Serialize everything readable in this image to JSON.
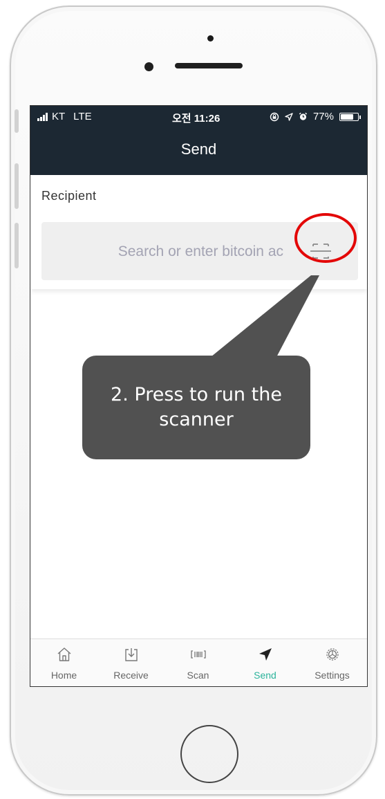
{
  "status_bar": {
    "carrier": "KT",
    "network": "LTE",
    "time": "오전 11:26",
    "battery": "77%",
    "battery_level": 0.77
  },
  "header": {
    "title": "Send"
  },
  "recipient": {
    "label": "Recipient",
    "search_placeholder": "Search or enter bitcoin ac",
    "scan_icon": "scan-frame-icon"
  },
  "callout": {
    "text": "2. Press to run the scanner"
  },
  "annotation": {
    "ring_color": "#e30808",
    "callout_color": "#515151"
  },
  "tabs": [
    {
      "label": "Home",
      "icon": "home-icon",
      "active": false
    },
    {
      "label": "Receive",
      "icon": "receive-icon",
      "active": false
    },
    {
      "label": "Scan",
      "icon": "barcode-icon",
      "active": false
    },
    {
      "label": "Send",
      "icon": "send-icon",
      "active": true
    },
    {
      "label": "Settings",
      "icon": "gear-icon",
      "active": false
    }
  ],
  "colors": {
    "header_bg": "#1c2833",
    "accent": "#2bb39b"
  }
}
